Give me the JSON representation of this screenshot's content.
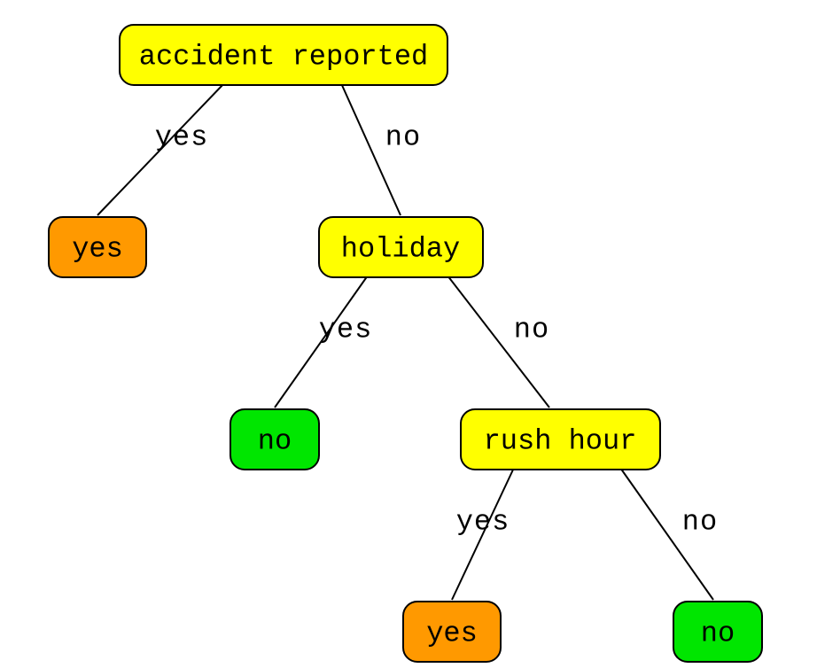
{
  "diagram": {
    "type": "decision-tree",
    "nodes": {
      "root": {
        "label": "accident reported",
        "kind": "decision"
      },
      "leaf_yes1": {
        "label": "yes",
        "kind": "leaf",
        "outcome": "yes"
      },
      "holiday": {
        "label": "holiday",
        "kind": "decision"
      },
      "leaf_no1": {
        "label": "no",
        "kind": "leaf",
        "outcome": "no"
      },
      "rush": {
        "label": "rush hour",
        "kind": "decision"
      },
      "leaf_yes2": {
        "label": "yes",
        "kind": "leaf",
        "outcome": "yes"
      },
      "leaf_no2": {
        "label": "no",
        "kind": "leaf",
        "outcome": "no"
      }
    },
    "edges": {
      "root_yes": {
        "from": "root",
        "to": "leaf_yes1",
        "label": "yes"
      },
      "root_no": {
        "from": "root",
        "to": "holiday",
        "label": "no"
      },
      "holiday_yes": {
        "from": "holiday",
        "to": "leaf_no1",
        "label": "yes"
      },
      "holiday_no": {
        "from": "holiday",
        "to": "rush",
        "label": "no"
      },
      "rush_yes": {
        "from": "rush",
        "to": "leaf_yes2",
        "label": "yes"
      },
      "rush_no": {
        "from": "rush",
        "to": "leaf_no2",
        "label": "no"
      }
    },
    "colors": {
      "decision": "#ffff00",
      "leaf_yes": "#ff9900",
      "leaf_no": "#00e600"
    }
  }
}
